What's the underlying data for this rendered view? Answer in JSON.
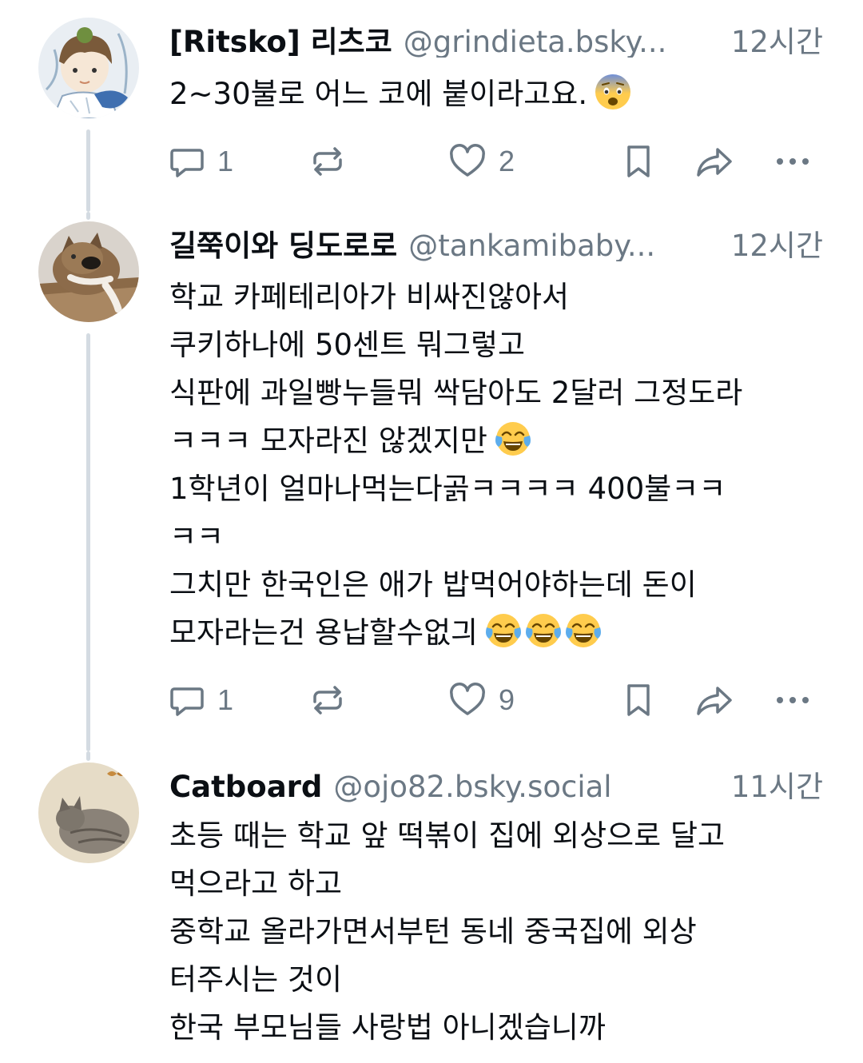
{
  "colors": {
    "text": "#0b0f14",
    "muted": "#6b7884",
    "thread_line": "#d4dbe2",
    "action_icon": "#6b7884"
  },
  "posts": [
    {
      "display_name": "[Ritsko] 리츠코",
      "handle": "@grindieta.bsky...",
      "time": "12시간",
      "lines": [
        "2~30불로 어느 코에 붙이라고요."
      ],
      "line_emojis": [
        [
          "fearful-face-emoji"
        ]
      ],
      "reply_count": "1",
      "like_count": "2",
      "avatar": "anime-sketch-avatar"
    },
    {
      "display_name": "길쭉이와 딩도로로",
      "handle": "@tankamibaby...",
      "time": "12시간",
      "lines": [
        "학교 카페테리아가 비싸진않아서",
        "쿠키하나에 50센트 뭐그렇고",
        "식판에 과일빵누들뭐 싹담아도 2달러 그정도라",
        "ㅋㅋㅋ 모자라진 않겠지만",
        "1학년이 얼마나먹는다곩ㅋㅋㅋㅋ 400불ㅋㅋ",
        "ㅋㅋ",
        "그치만 한국인은 애가 밥먹어야하는데 돈이",
        "모자라는건 용납할수없긔"
      ],
      "line_emojis": [
        [],
        [],
        [],
        [
          "face-with-tears-of-joy-emoji"
        ],
        [],
        [],
        [],
        [
          "face-with-tears-of-joy-emoji",
          "face-with-tears-of-joy-emoji",
          "face-with-tears-of-joy-emoji"
        ]
      ],
      "reply_count": "1",
      "like_count": "9",
      "avatar": "cat-photo-avatar"
    },
    {
      "display_name": "Catboard",
      "handle": "@ojo82.bsky.social",
      "time": "11시간",
      "lines": [
        "초등 때는 학교 앞 떡볶이 집에 외상으로 달고",
        "먹으라고 하고",
        "중학교 올라가면서부턴 동네 중국집에 외상",
        "터주시는 것이",
        "한국 부모님들 사랑법 아니겠습니까"
      ],
      "avatar": "cat-painting-avatar"
    }
  ],
  "icons": {
    "reply": "reply-bubble-icon",
    "repost": "repost-arrows-icon",
    "like": "heart-icon",
    "bookmark": "bookmark-icon",
    "share": "share-arrow-icon",
    "more": "more-dots-icon"
  }
}
